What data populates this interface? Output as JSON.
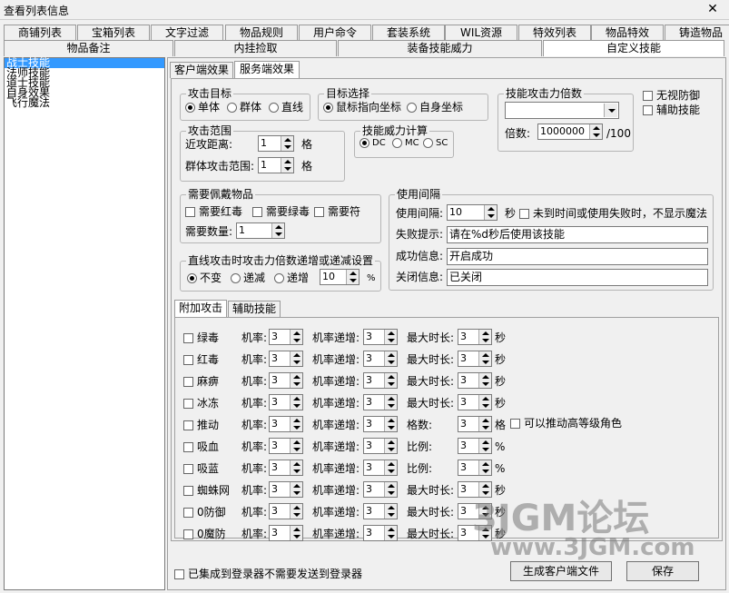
{
  "window": {
    "title": "查看列表信息",
    "close": "✕"
  },
  "tabs_row1": [
    "商铺列表",
    "宝箱列表",
    "文字过滤",
    "物品规则",
    "用户命令",
    "套装系统",
    "WIL资源",
    "特效列表",
    "物品特效",
    "铸造物品"
  ],
  "tabs_row2": [
    "物品备注",
    "内挂捡取",
    "装备技能威力",
    "自定义技能"
  ],
  "list": [
    "战士技能",
    "法师技能",
    "道士技能",
    "自身效果",
    "飞行魔法"
  ],
  "subtabs": [
    "客户端效果",
    "服务端效果"
  ],
  "target": {
    "legend": "攻击目标",
    "opts": [
      "单体",
      "群体",
      "直线"
    ]
  },
  "select": {
    "legend": "目标选择",
    "opts": [
      "鼠标指向坐标",
      "自身坐标"
    ]
  },
  "multiplier": {
    "legend": "技能攻击力倍数",
    "label": "倍数:",
    "value": "1000000",
    "unit": "/100"
  },
  "checks_right": [
    "无视防御",
    "辅助技能"
  ],
  "range": {
    "legend": "攻击范围",
    "near": "近攻距离:",
    "near_val": "1",
    "group": "群体攻击范围:",
    "group_val": "1",
    "unit": "格"
  },
  "power": {
    "legend": "技能威力计算",
    "opts": [
      "DC",
      "MC",
      "SC"
    ]
  },
  "items": {
    "legend": "需要佩戴物品",
    "opts": [
      "需要红毒",
      "需要绿毒",
      "需要符"
    ],
    "qty_label": "需要数量:",
    "qty": "1"
  },
  "interval": {
    "legend": "使用间隔",
    "label": "使用间隔:",
    "value": "10",
    "unit": "秒",
    "check": "未到时间或使用失败时，不显示魔法",
    "fail_label": "失败提示:",
    "fail": "请在%d秒后使用该技能",
    "ok_label": "成功信息:",
    "ok": "开启成功",
    "close_label": "关闭信息:",
    "close": "已关闭"
  },
  "linear": {
    "legend": "直线攻击时攻击力倍数递增或递减设置",
    "opts": [
      "不变",
      "递减",
      "递增"
    ],
    "value": "10",
    "unit": "%"
  },
  "bottom_tabs": [
    "附加攻击",
    "辅助技能"
  ],
  "attack_rows": [
    {
      "name": "绿毒",
      "rate": "3",
      "inc": "3",
      "l3": "最大时长:",
      "v3": "3",
      "u3": "秒"
    },
    {
      "name": "红毒",
      "rate": "3",
      "inc": "3",
      "l3": "最大时长:",
      "v3": "3",
      "u3": "秒"
    },
    {
      "name": "麻痹",
      "rate": "3",
      "inc": "3",
      "l3": "最大时长:",
      "v3": "3",
      "u3": "秒"
    },
    {
      "name": "冰冻",
      "rate": "3",
      "inc": "3",
      "l3": "最大时长:",
      "v3": "3",
      "u3": "秒"
    },
    {
      "name": "推动",
      "rate": "3",
      "inc": "3",
      "l3": "格数:",
      "v3": "3",
      "u3": "格"
    },
    {
      "name": "吸血",
      "rate": "3",
      "inc": "3",
      "l3": "比例:",
      "v3": "3",
      "u3": "%"
    },
    {
      "name": "吸蓝",
      "rate": "3",
      "inc": "3",
      "l3": "比例:",
      "v3": "3",
      "u3": "%"
    },
    {
      "name": "蜘蛛网",
      "rate": "3",
      "inc": "3",
      "l3": "最大时长:",
      "v3": "3",
      "u3": "秒"
    },
    {
      "name": "0防御",
      "rate": "3",
      "inc": "3",
      "l3": "最大时长:",
      "v3": "3",
      "u3": "秒"
    },
    {
      "name": "0魔防",
      "rate": "3",
      "inc": "3",
      "l3": "最大时长:",
      "v3": "3",
      "u3": "秒"
    }
  ],
  "row_labels": {
    "rate": "机率:",
    "inc": "机率递增:"
  },
  "push_check": "可以推动高等级角色",
  "footer": {
    "check": "已集成到登录器不需要发送到登录器",
    "btn1": "生成客户端文件",
    "btn2": "保存"
  },
  "watermark": {
    "text1": "3JGM论坛",
    "text2": "www.3JGM.com"
  }
}
